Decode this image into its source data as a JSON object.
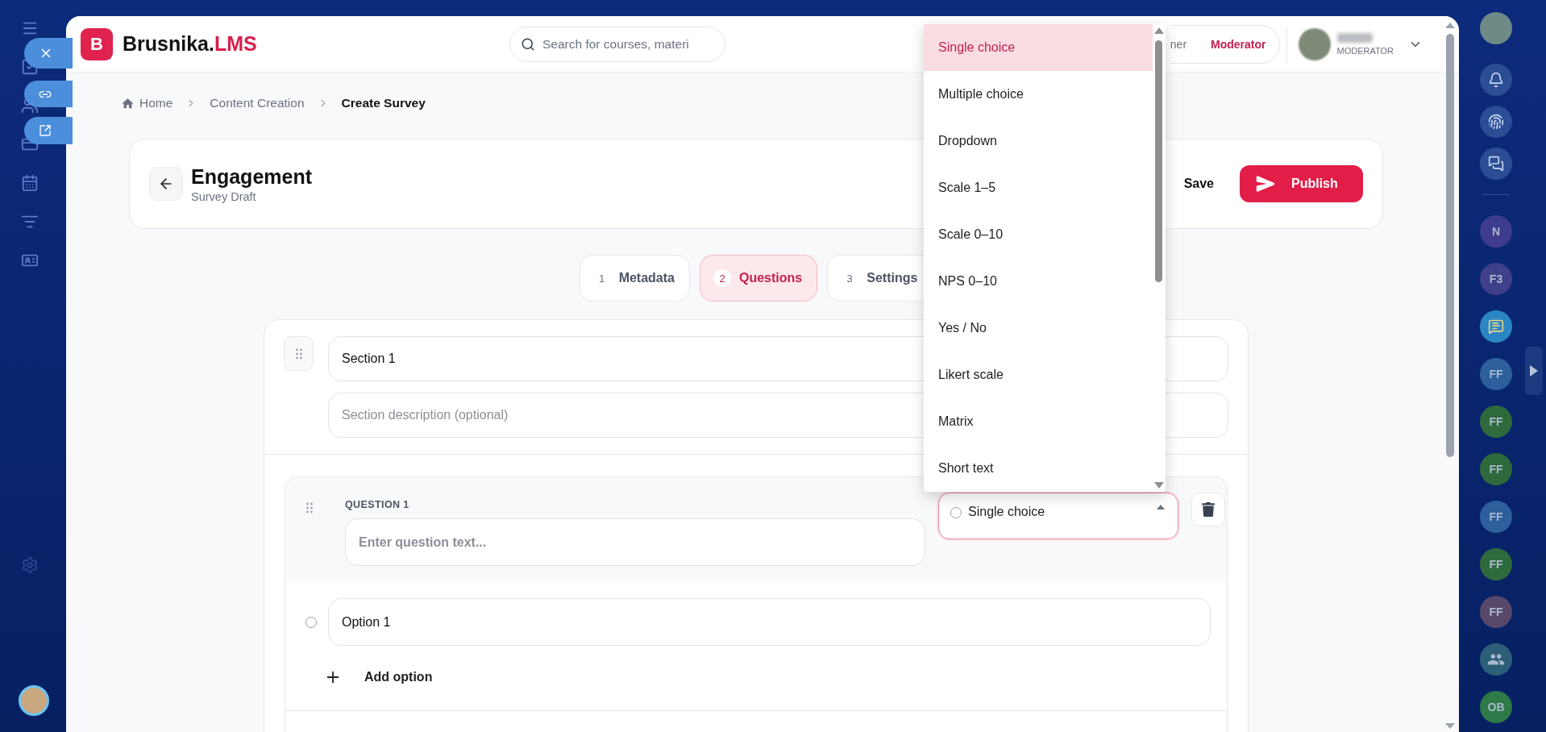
{
  "app": {
    "logo_letter": "B",
    "brand": "Brusnika.",
    "brand_suffix": "LMS"
  },
  "search": {
    "placeholder": "Search for courses, materi"
  },
  "role_switch": [
    {
      "label": "ner",
      "selected": false
    },
    {
      "label": "Moderator",
      "selected": true
    }
  ],
  "user": {
    "role": "MODERATOR"
  },
  "breadcrumb": [
    {
      "label": "Home",
      "current": false
    },
    {
      "label": "Content Creation",
      "current": false
    },
    {
      "label": "Create Survey",
      "current": true
    }
  ],
  "survey_header": {
    "title": "Engagement",
    "subtitle": "Survey Draft",
    "save": "Save",
    "publish": "Publish"
  },
  "steps": [
    {
      "number": "1",
      "label": "Metadata",
      "selected": false
    },
    {
      "number": "2",
      "label": "Questions",
      "selected": true
    },
    {
      "number": "3",
      "label": "Settings",
      "selected": false
    }
  ],
  "section": {
    "title_value": "Section 1",
    "description_placeholder": "Section description (optional)"
  },
  "question": {
    "label": "QUESTION 1",
    "text_placeholder": "Enter question text...",
    "type": "Single choice",
    "type_open": true,
    "options": [
      {
        "value": "Option 1",
        "selected": false
      }
    ],
    "add_option": "Add option"
  },
  "type_menu": [
    {
      "label": "Single choice",
      "selected": true
    },
    {
      "label": "Multiple choice",
      "selected": false
    },
    {
      "label": "Dropdown",
      "selected": false
    },
    {
      "label": "Scale 1–5",
      "selected": false
    },
    {
      "label": "Scale 0–10",
      "selected": false
    },
    {
      "label": "NPS 0–10",
      "selected": false
    },
    {
      "label": "Yes / No",
      "selected": false
    },
    {
      "label": "Likert scale",
      "selected": false
    },
    {
      "label": "Matrix",
      "selected": false
    },
    {
      "label": "Short text",
      "selected": false
    }
  ],
  "contacts": [
    {
      "kind": "initials",
      "initials": "N",
      "color": "#3f3c8e"
    },
    {
      "kind": "initials",
      "initials": "F3",
      "color": "#403f8c"
    },
    {
      "kind": "chat",
      "color": "#2b86c4"
    },
    {
      "kind": "initials",
      "initials": "FF",
      "color": "#2c5f9c"
    },
    {
      "kind": "initials",
      "initials": "FF",
      "color": "#2f6a3c"
    },
    {
      "kind": "initials",
      "initials": "FF",
      "color": "#2f6a3c"
    },
    {
      "kind": "initials",
      "initials": "FF",
      "color": "#2c5f9c"
    },
    {
      "kind": "initials",
      "initials": "FF",
      "color": "#2f6a3c"
    },
    {
      "kind": "initials",
      "initials": "FF",
      "color": "#58496b"
    },
    {
      "kind": "group",
      "color": "#2d5e78"
    },
    {
      "kind": "initials",
      "initials": "OB",
      "color": "#2e7a48"
    }
  ]
}
